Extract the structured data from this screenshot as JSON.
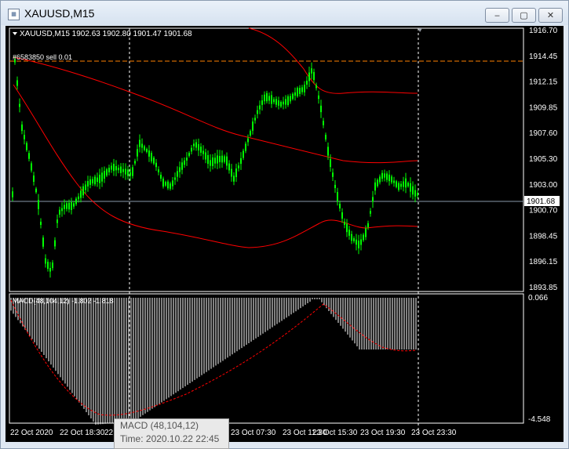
{
  "window": {
    "title": "XAUUSD,M15",
    "icon": "chart-window-icon",
    "minimize": "‒",
    "maximize": "▢",
    "close": "✕"
  },
  "header": {
    "symbol_info": "XAUUSD,M15  1902.63 1902.80 1901.47 1901.68",
    "order_line": "#6583850 sell 0.01"
  },
  "price_axis": {
    "ticks": [
      "1916.70",
      "1914.45",
      "1912.15",
      "1909.85",
      "1907.60",
      "1905.30",
      "1903.00",
      "1900.70",
      "1898.45",
      "1896.15",
      "1893.85"
    ],
    "current_price": "1901.68"
  },
  "indicator": {
    "label": "MACD(48,104,12) -1.802 -1.818",
    "axis_top": "0.066",
    "axis_bottom": "-4.548"
  },
  "time_axis": [
    "22 Oct 2020",
    "22 Oct 18:30",
    "22 Oct 21:30",
    "23 Oct 03:30",
    "23 Oct 07:30",
    "23 Oct 11:30",
    "23 Oct 15:30",
    "23 Oct 19:30",
    "23 Oct 23:30"
  ],
  "tooltip": {
    "line1": "MACD (48,104,12)",
    "line2": "Time: 2020.10.22 22:45"
  },
  "colors": {
    "bull_candle": "#00ff00",
    "bear_candle": "#00ff00",
    "envelope": "#ff0000",
    "order_line": "#ff8000",
    "macd_hist": "#ffffff",
    "macd_signal": "#ff0000",
    "grid": "#ffffff",
    "price_line": "#8899aa"
  }
}
